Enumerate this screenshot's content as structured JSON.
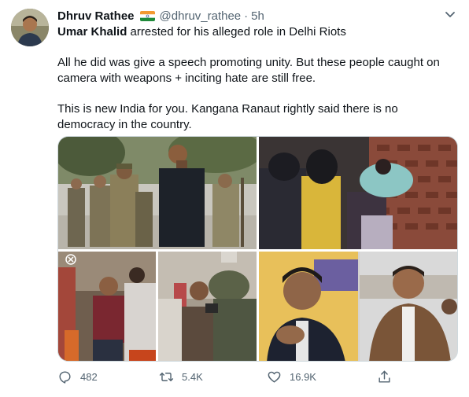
{
  "author": {
    "display_name": "Dhruv Rathee",
    "handle": "@dhruv_rathee",
    "separator": "·",
    "time": "5h",
    "flag_icon": "india-flag-icon"
  },
  "tweet": {
    "mention_name": "Umar Khalid",
    "line1_rest": " arrested for his alleged role in Delhi Riots",
    "para2": "All he did was give a speech promoting unity. But these people caught on camera with weapons + inciting hate are still free.",
    "para3": "This is new India for you. Kangana Ranaut rightly said there is no democracy in the country."
  },
  "media": {
    "photo_count": 4
  },
  "actions": {
    "reply_count": "482",
    "retweet_count": "5.4K",
    "like_count": "16.9K"
  },
  "colors": {
    "text_primary": "#0f1419",
    "text_secondary": "#536471",
    "border": "#cfd9de"
  }
}
